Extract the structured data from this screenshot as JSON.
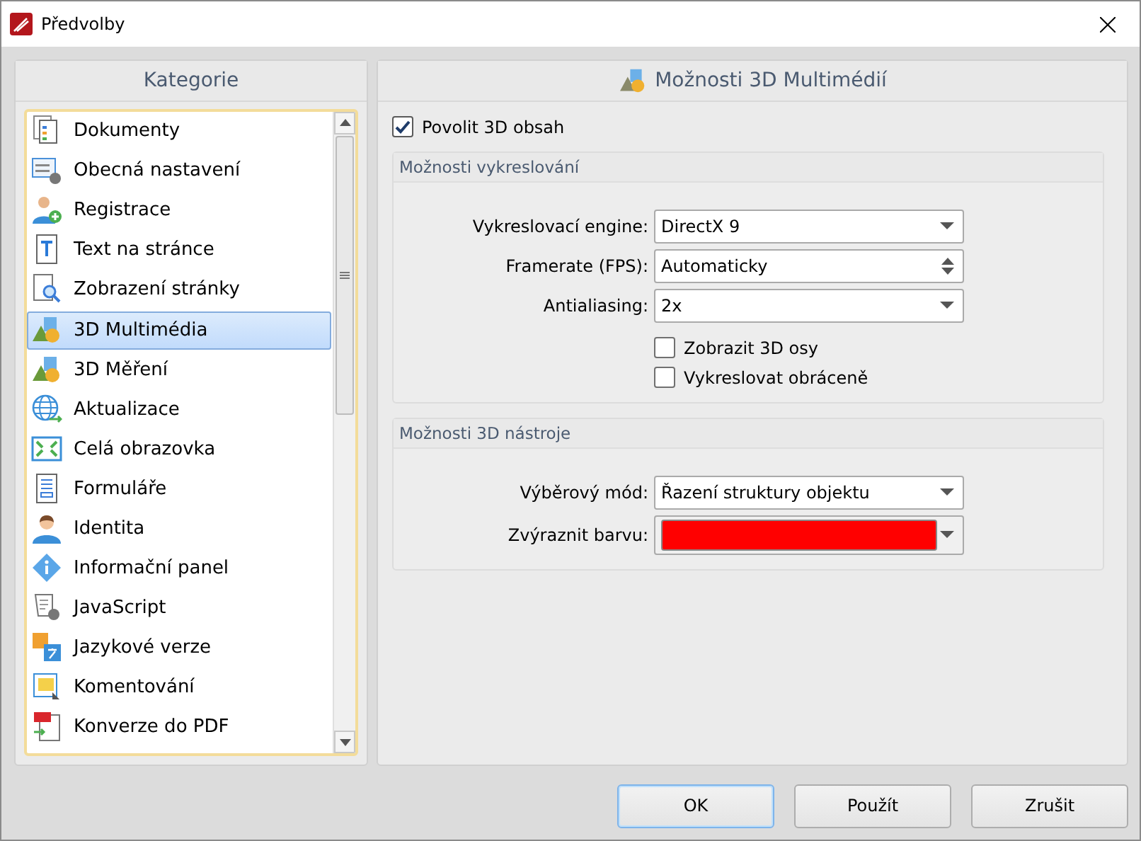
{
  "window": {
    "title": "Předvolby"
  },
  "categories": {
    "title": "Kategorie",
    "items": [
      {
        "label": "Dokumenty",
        "selected": false
      },
      {
        "label": "Obecná nastavení",
        "selected": false
      },
      {
        "label": "Registrace",
        "selected": false
      },
      {
        "label": "Text na stránce",
        "selected": false
      },
      {
        "label": "Zobrazení stránky",
        "selected": false
      },
      {
        "label": "3D Multimédia",
        "selected": true
      },
      {
        "label": "3D Měření",
        "selected": false
      },
      {
        "label": "Aktualizace",
        "selected": false
      },
      {
        "label": "Celá obrazovka",
        "selected": false
      },
      {
        "label": "Formuláře",
        "selected": false
      },
      {
        "label": "Identita",
        "selected": false
      },
      {
        "label": "Informační panel",
        "selected": false
      },
      {
        "label": "JavaScript",
        "selected": false
      },
      {
        "label": "Jazykové verze",
        "selected": false
      },
      {
        "label": "Komentování",
        "selected": false
      },
      {
        "label": "Konverze do PDF",
        "selected": false
      }
    ]
  },
  "panel": {
    "title": "Možnosti 3D Multimédií",
    "enable": {
      "label": "Povolit 3D obsah",
      "checked": true
    },
    "groups": [
      {
        "title": "Možnosti vykreslování",
        "rows": [
          {
            "kind": "select",
            "label": "Vykreslovací engine:",
            "value": "DirectX 9"
          },
          {
            "kind": "spin",
            "label": "Framerate (FPS):",
            "value": "Automaticky"
          },
          {
            "kind": "select",
            "label": "Antialiasing:",
            "value": "2x"
          }
        ],
        "checks": [
          {
            "label": "Zobrazit 3D osy",
            "checked": false
          },
          {
            "label": "Vykreslovat obráceně",
            "checked": false
          }
        ]
      },
      {
        "title": "Možnosti 3D nástroje",
        "rows": [
          {
            "kind": "select",
            "label": "Výběrový mód:",
            "value": "Řazení struktury objektu"
          },
          {
            "kind": "color",
            "label": "Zvýraznit barvu:",
            "color": "#ff0000"
          }
        ]
      }
    ]
  },
  "buttons": [
    {
      "label": "OK",
      "default": true
    },
    {
      "label": "Použít",
      "default": false
    },
    {
      "label": "Zrušit",
      "default": false
    }
  ]
}
